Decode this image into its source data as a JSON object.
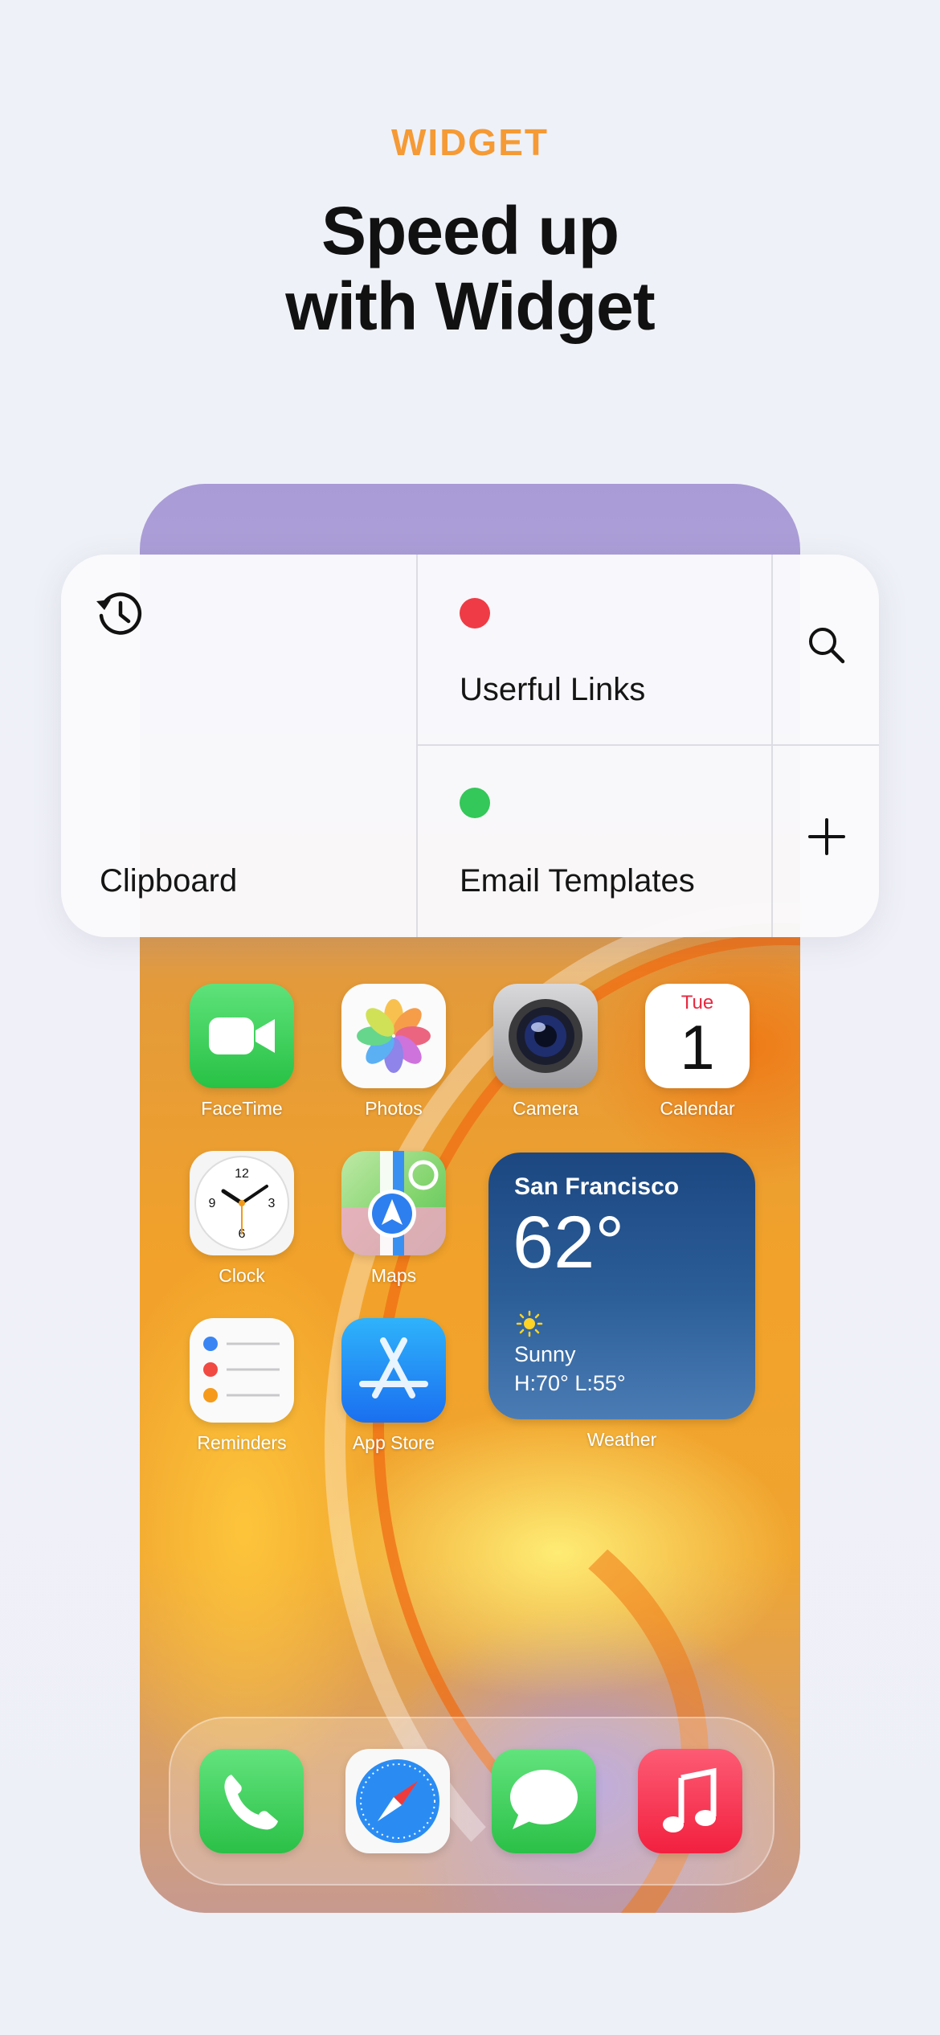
{
  "header": {
    "eyebrow": "WIDGET",
    "title_line1": "Speed up",
    "title_line2": "with Widget"
  },
  "widget": {
    "clipboard": {
      "icon": "history-icon",
      "label": "Clipboard"
    },
    "items": [
      {
        "label": "Userful Links",
        "dot_color": "#ef3b45"
      },
      {
        "label": "Email Templates",
        "dot_color": "#34c759"
      }
    ],
    "actions": [
      {
        "icon": "search-icon"
      },
      {
        "icon": "plus-icon"
      }
    ]
  },
  "home": {
    "apps": [
      {
        "label": "FaceTime",
        "icon": "facetime-icon"
      },
      {
        "label": "Photos",
        "icon": "photos-icon"
      },
      {
        "label": "Camera",
        "icon": "camera-icon"
      },
      {
        "label": "Calendar",
        "icon": "calendar-icon",
        "day": "Tue",
        "date": "1"
      },
      {
        "label": "Clock",
        "icon": "clock-icon"
      },
      {
        "label": "Maps",
        "icon": "maps-icon"
      },
      {
        "label": "Reminders",
        "icon": "reminders-icon"
      },
      {
        "label": "App Store",
        "icon": "app-store-icon"
      }
    ],
    "weather": {
      "label": "Weather",
      "city": "San Francisco",
      "temp": "62°",
      "condition": "Sunny",
      "high_low": "H:70° L:55°"
    },
    "dock": [
      {
        "icon": "phone-icon"
      },
      {
        "icon": "safari-icon"
      },
      {
        "icon": "messages-icon"
      },
      {
        "icon": "music-icon"
      }
    ]
  }
}
